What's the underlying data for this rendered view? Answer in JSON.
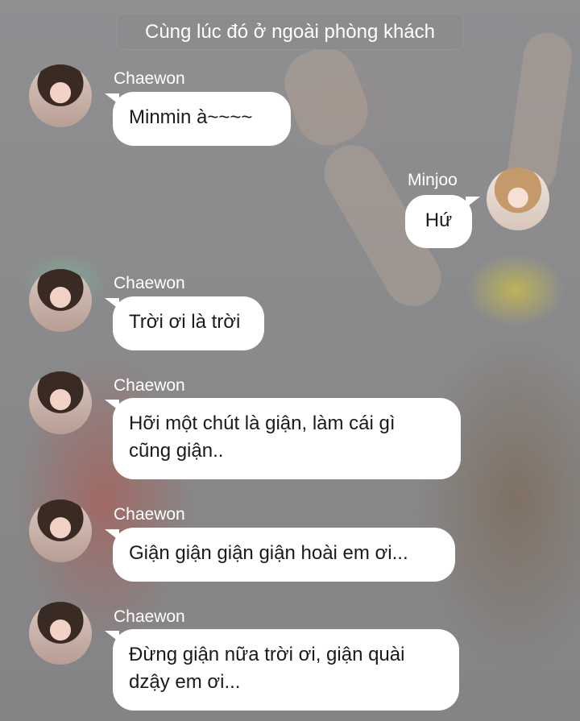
{
  "header": {
    "text": "Cùng lúc đó ở ngoài phòng khách"
  },
  "messages": [
    {
      "sender": "Chaewon",
      "side": "left",
      "text": "Minmin à~~~~"
    },
    {
      "sender": "Minjoo",
      "side": "right",
      "text": "Hứ"
    },
    {
      "sender": "Chaewon",
      "side": "left",
      "text": "Trời ơi là trời"
    },
    {
      "sender": "Chaewon",
      "side": "left",
      "text": "Hỡi một chút là giận, làm cái gì\ncũng giận.."
    },
    {
      "sender": "Chaewon",
      "side": "left",
      "text": "Giận giận giận giận hoài em ơi..."
    },
    {
      "sender": "Chaewon",
      "side": "left",
      "text": "Đừng giận nữa trời ơi, giận quài\ndzậy em ơi..."
    }
  ]
}
